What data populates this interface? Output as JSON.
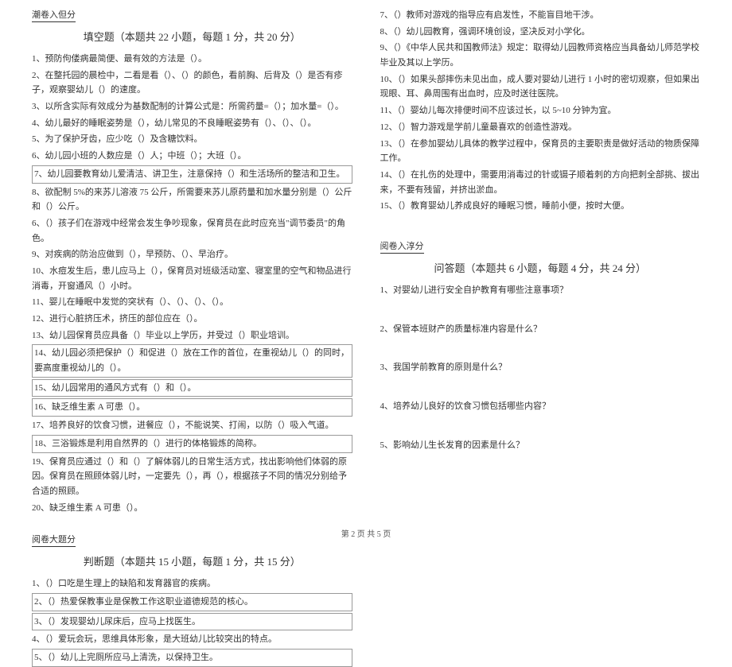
{
  "leftCol": {
    "header1": "潮卷入但分",
    "section1Title": "填空题（本题共 22 小题，每题 1 分，共 20 分）",
    "fillBlanks": [
      "1、预防佝偻病最简便、最有效的方法是（）。",
      "2、在整托园的晨检中，二看是看（）、（）的颜色，看前胸、后背及（）是否有疹子，观察婴幼儿（）的速度。",
      "3、以所含实际有效成分为基数配制的计算公式是：所需药量=（）；加水量=（）。",
      "4、幼儿最好的睡眠姿势是（），幼儿常见的不良睡眠姿势有（）、（）、（）。",
      "5、为了保护牙齿，应少吃（）及含糖饮料。",
      "6、幼儿园小班的人数应是（）人；中班（）；大班（）。",
      "7、幼儿园要教育幼儿爱清洁、讲卫生，注意保持（）和生活场所的整洁和卫生。",
      "8、欲配制 5%的来苏儿溶液 75 公斤，所需要来苏儿原药量和加水量分别是（）公斤和（）公斤。",
      "6、（）孩子们在游戏中经常会发生争吵现象，保育员在此时应充当\"调节委员\"的角色。",
      "9、对疾病的防治应做到（），早预防、（）、早治疗。",
      "10、水痘发生后，患儿应马上（），保育员对班级活动室、寝室里的空气和物品进行消毒，开窗通风（）小时。",
      "11、婴儿在睡眠中发觉的突状有（）、（）、（）、（）。",
      "12、进行心脏挤压术，挤压的部位应在（）。",
      "13、幼儿园保育员应具备（）毕业以上学历，并受过（）职业培训。",
      "14、幼儿园必须把保护（）和促进（）放在工作的首位，在重视幼儿（）的同时，要高度重视幼儿的（）。",
      "15、幼儿园常用的通风方式有（）和（）。",
      "16、缺乏维生素 A 可患（）。",
      "17、培养良好的饮食习惯，进餐应（），不能说笑、打闹，以防（）吸入气道。",
      "18、三浴锻炼是利用自然界的（）进行的体格锻炼的简称。",
      "19、保育员应通过（）和（）了解体弱儿的日常生活方式，找出影响他们体弱的原因。保育员在照顾体弱儿时，一定要先（），再（），根据孩子不同的情况分别给予合适的照顾。",
      "20、缺乏维生素 A 可患（）。"
    ],
    "header2": "阅卷大题分",
    "section2Title": "判断题（本题共 15 小题，每题 1 分，共 15 分）",
    "judgments": [
      "1、（）口吃是生理上的缺陷和发育器官的疾病。",
      "2、（）热爱保教事业是保教工作这职业道德规范的核心。",
      "3、（）发现婴幼儿尿床后，应马上找医生。",
      "4、（）爱玩会玩，思维具体形象，是大班幼儿比较突出的特点。",
      "5、（）幼儿上完厕所应马上清洗，以保持卫生。"
    ]
  },
  "rightCol": {
    "judgmentsContinued": [
      "7、（）教师对游戏的指导应有启发性，不能盲目地干涉。",
      "8、（）幼儿园教育，强调环境创设，坚决反对小学化。",
      "9、（）《中华人民共和国教师法》规定：取得幼儿园教师资格应当具备幼儿师范学校毕业及其以上学历。",
      "10、（）如果头部摔伤未见出血，成人要对婴幼儿进行 1 小时的密切观察，但如果出现眼、耳、鼻周围有出血时，应及时送往医院。",
      "11、（）婴幼儿每次排便时间不应该过长，以 5~10 分钟为宜。",
      "12、（）智力游戏是学前儿童最喜欢的创造性游戏。",
      "13、（）在参加婴幼儿具体的教学过程中，保育员的主要职责是做好活动的物质保障工作。",
      "14、（）在扎伤的处理中，需要用消毒过的针或镊子顺着刺的方向把刺全部挑、拔出来，不要有残留，并挤出淤血。",
      "15、（）教育婴幼儿养成良好的睡眠习惯，睡前小便，按时大便。"
    ],
    "header3": "阅卷入淳分",
    "section3Title": "问答题（本题共 6 小题，每题 4 分，共 24 分）",
    "shortAnswers": [
      "1、对婴幼儿进行安全自护教育有哪些注意事项？",
      "2、保管本班财产的质量标准内容是什么？",
      "3、我国学前教育的原则是什么？",
      "4、培养幼儿良好的饮食习惯包括哪些内容？",
      "5、影响幼儿生长发育的因素是什么？"
    ]
  },
  "footer": "第 2 页 共 5 页"
}
